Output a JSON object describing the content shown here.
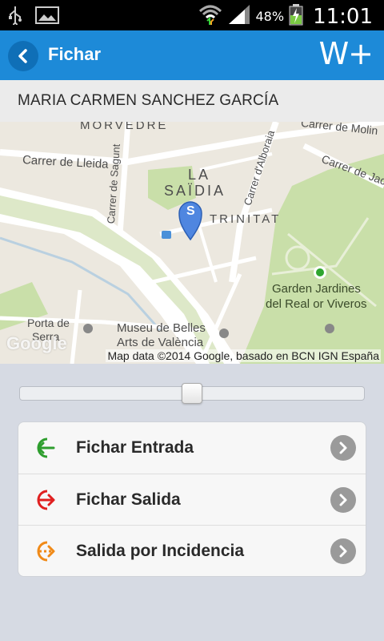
{
  "status_bar": {
    "icons": [
      "usb-icon",
      "image-icon",
      "wifi-icon",
      "signal-icon",
      "battery-icon"
    ],
    "battery_percent": "48%",
    "time": "11:01"
  },
  "action_bar": {
    "title": "Fichar",
    "logo": "W+",
    "color": "#1d8ad8"
  },
  "employee": {
    "name": "MARIA CARMEN SANCHEZ GARCÍA"
  },
  "map": {
    "labels": {
      "morvedre": "MORVEDRE",
      "carrer_molino": "Carrer de Molin",
      "carrer_lleida": "Carrer de Lleida",
      "carrer_sagunt": "Carrer de Sagunt",
      "la": "LA",
      "saidia": "SAÏDIA",
      "carrer_alboraia": "Carrer d'Alboraia",
      "carrer_jac": "Carrer de Jac",
      "trinitat": "TRINITAT",
      "garden": "Garden Jardines",
      "real": "del Real or Viveros",
      "porta1": "Porta de",
      "porta2": "Serra",
      "museu1": "Museu de Belles",
      "museu2": "Arts de València"
    },
    "pin_label": "S",
    "watermark": "Google",
    "attribution": "Map data ©2014 Google, basado en BCN IGN España"
  },
  "slider": {
    "value": 0.5
  },
  "actions": [
    {
      "label": "Fichar Entrada",
      "icon": "entry-icon",
      "color": "#2e9e2e"
    },
    {
      "label": "Fichar Salida",
      "icon": "exit-icon",
      "color": "#e02020"
    },
    {
      "label": "Salida por Incidencia",
      "icon": "incident-exit-icon",
      "color": "#f08a18"
    }
  ]
}
